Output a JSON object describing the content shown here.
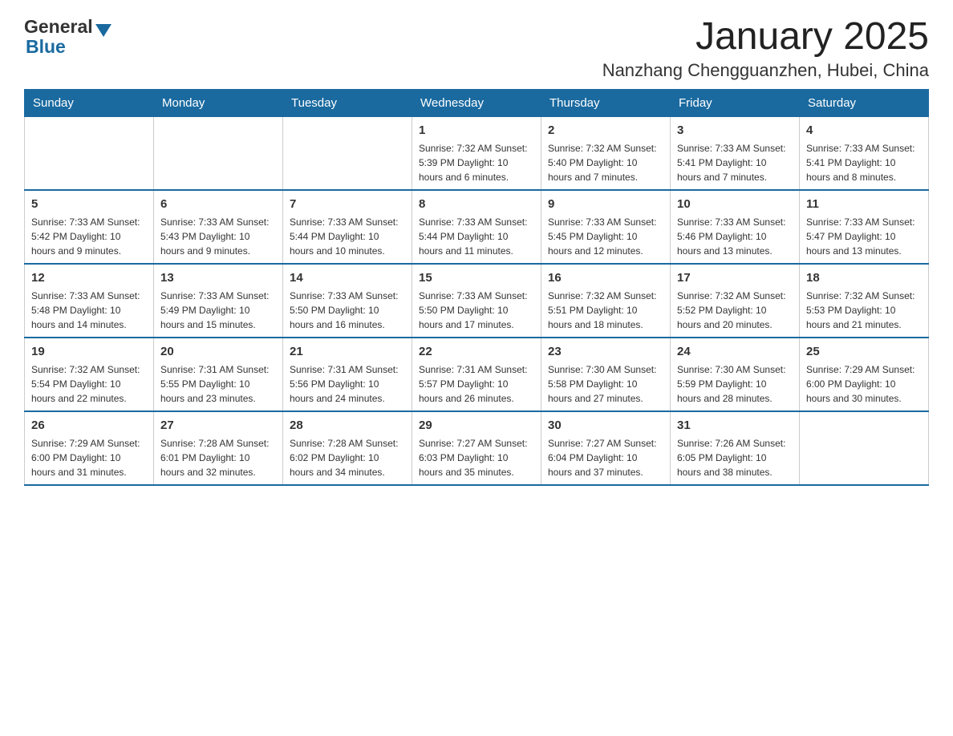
{
  "header": {
    "title": "January 2025",
    "subtitle": "Nanzhang Chengguanzhen, Hubei, China",
    "logo_general": "General",
    "logo_blue": "Blue"
  },
  "days_of_week": [
    "Sunday",
    "Monday",
    "Tuesday",
    "Wednesday",
    "Thursday",
    "Friday",
    "Saturday"
  ],
  "weeks": [
    [
      {
        "day": "",
        "info": ""
      },
      {
        "day": "",
        "info": ""
      },
      {
        "day": "",
        "info": ""
      },
      {
        "day": "1",
        "info": "Sunrise: 7:32 AM\nSunset: 5:39 PM\nDaylight: 10 hours and 6 minutes."
      },
      {
        "day": "2",
        "info": "Sunrise: 7:32 AM\nSunset: 5:40 PM\nDaylight: 10 hours and 7 minutes."
      },
      {
        "day": "3",
        "info": "Sunrise: 7:33 AM\nSunset: 5:41 PM\nDaylight: 10 hours and 7 minutes."
      },
      {
        "day": "4",
        "info": "Sunrise: 7:33 AM\nSunset: 5:41 PM\nDaylight: 10 hours and 8 minutes."
      }
    ],
    [
      {
        "day": "5",
        "info": "Sunrise: 7:33 AM\nSunset: 5:42 PM\nDaylight: 10 hours and 9 minutes."
      },
      {
        "day": "6",
        "info": "Sunrise: 7:33 AM\nSunset: 5:43 PM\nDaylight: 10 hours and 9 minutes."
      },
      {
        "day": "7",
        "info": "Sunrise: 7:33 AM\nSunset: 5:44 PM\nDaylight: 10 hours and 10 minutes."
      },
      {
        "day": "8",
        "info": "Sunrise: 7:33 AM\nSunset: 5:44 PM\nDaylight: 10 hours and 11 minutes."
      },
      {
        "day": "9",
        "info": "Sunrise: 7:33 AM\nSunset: 5:45 PM\nDaylight: 10 hours and 12 minutes."
      },
      {
        "day": "10",
        "info": "Sunrise: 7:33 AM\nSunset: 5:46 PM\nDaylight: 10 hours and 13 minutes."
      },
      {
        "day": "11",
        "info": "Sunrise: 7:33 AM\nSunset: 5:47 PM\nDaylight: 10 hours and 13 minutes."
      }
    ],
    [
      {
        "day": "12",
        "info": "Sunrise: 7:33 AM\nSunset: 5:48 PM\nDaylight: 10 hours and 14 minutes."
      },
      {
        "day": "13",
        "info": "Sunrise: 7:33 AM\nSunset: 5:49 PM\nDaylight: 10 hours and 15 minutes."
      },
      {
        "day": "14",
        "info": "Sunrise: 7:33 AM\nSunset: 5:50 PM\nDaylight: 10 hours and 16 minutes."
      },
      {
        "day": "15",
        "info": "Sunrise: 7:33 AM\nSunset: 5:50 PM\nDaylight: 10 hours and 17 minutes."
      },
      {
        "day": "16",
        "info": "Sunrise: 7:32 AM\nSunset: 5:51 PM\nDaylight: 10 hours and 18 minutes."
      },
      {
        "day": "17",
        "info": "Sunrise: 7:32 AM\nSunset: 5:52 PM\nDaylight: 10 hours and 20 minutes."
      },
      {
        "day": "18",
        "info": "Sunrise: 7:32 AM\nSunset: 5:53 PM\nDaylight: 10 hours and 21 minutes."
      }
    ],
    [
      {
        "day": "19",
        "info": "Sunrise: 7:32 AM\nSunset: 5:54 PM\nDaylight: 10 hours and 22 minutes."
      },
      {
        "day": "20",
        "info": "Sunrise: 7:31 AM\nSunset: 5:55 PM\nDaylight: 10 hours and 23 minutes."
      },
      {
        "day": "21",
        "info": "Sunrise: 7:31 AM\nSunset: 5:56 PM\nDaylight: 10 hours and 24 minutes."
      },
      {
        "day": "22",
        "info": "Sunrise: 7:31 AM\nSunset: 5:57 PM\nDaylight: 10 hours and 26 minutes."
      },
      {
        "day": "23",
        "info": "Sunrise: 7:30 AM\nSunset: 5:58 PM\nDaylight: 10 hours and 27 minutes."
      },
      {
        "day": "24",
        "info": "Sunrise: 7:30 AM\nSunset: 5:59 PM\nDaylight: 10 hours and 28 minutes."
      },
      {
        "day": "25",
        "info": "Sunrise: 7:29 AM\nSunset: 6:00 PM\nDaylight: 10 hours and 30 minutes."
      }
    ],
    [
      {
        "day": "26",
        "info": "Sunrise: 7:29 AM\nSunset: 6:00 PM\nDaylight: 10 hours and 31 minutes."
      },
      {
        "day": "27",
        "info": "Sunrise: 7:28 AM\nSunset: 6:01 PM\nDaylight: 10 hours and 32 minutes."
      },
      {
        "day": "28",
        "info": "Sunrise: 7:28 AM\nSunset: 6:02 PM\nDaylight: 10 hours and 34 minutes."
      },
      {
        "day": "29",
        "info": "Sunrise: 7:27 AM\nSunset: 6:03 PM\nDaylight: 10 hours and 35 minutes."
      },
      {
        "day": "30",
        "info": "Sunrise: 7:27 AM\nSunset: 6:04 PM\nDaylight: 10 hours and 37 minutes."
      },
      {
        "day": "31",
        "info": "Sunrise: 7:26 AM\nSunset: 6:05 PM\nDaylight: 10 hours and 38 minutes."
      },
      {
        "day": "",
        "info": ""
      }
    ]
  ]
}
